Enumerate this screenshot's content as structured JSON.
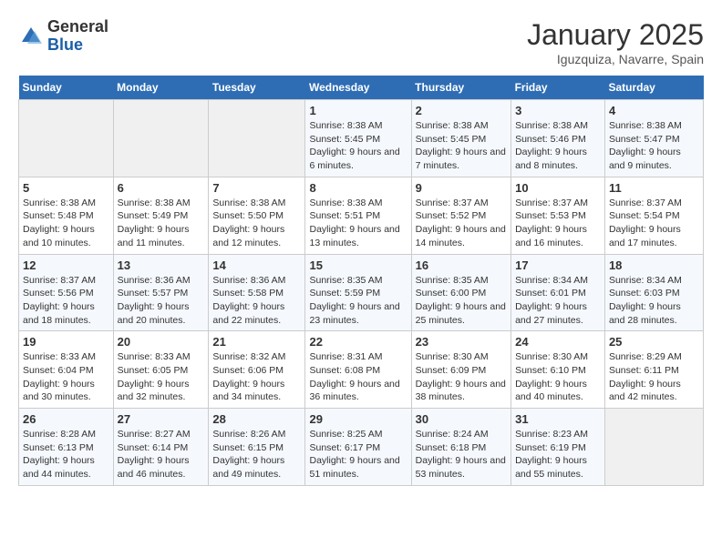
{
  "header": {
    "logo_general": "General",
    "logo_blue": "Blue",
    "month_title": "January 2025",
    "location": "Iguzquiza, Navarre, Spain"
  },
  "weekdays": [
    "Sunday",
    "Monday",
    "Tuesday",
    "Wednesday",
    "Thursday",
    "Friday",
    "Saturday"
  ],
  "weeks": [
    [
      {
        "day": "",
        "sunrise": "",
        "sunset": "",
        "daylight": ""
      },
      {
        "day": "",
        "sunrise": "",
        "sunset": "",
        "daylight": ""
      },
      {
        "day": "",
        "sunrise": "",
        "sunset": "",
        "daylight": ""
      },
      {
        "day": "1",
        "sunrise": "Sunrise: 8:38 AM",
        "sunset": "Sunset: 5:45 PM",
        "daylight": "Daylight: 9 hours and 6 minutes."
      },
      {
        "day": "2",
        "sunrise": "Sunrise: 8:38 AM",
        "sunset": "Sunset: 5:45 PM",
        "daylight": "Daylight: 9 hours and 7 minutes."
      },
      {
        "day": "3",
        "sunrise": "Sunrise: 8:38 AM",
        "sunset": "Sunset: 5:46 PM",
        "daylight": "Daylight: 9 hours and 8 minutes."
      },
      {
        "day": "4",
        "sunrise": "Sunrise: 8:38 AM",
        "sunset": "Sunset: 5:47 PM",
        "daylight": "Daylight: 9 hours and 9 minutes."
      }
    ],
    [
      {
        "day": "5",
        "sunrise": "Sunrise: 8:38 AM",
        "sunset": "Sunset: 5:48 PM",
        "daylight": "Daylight: 9 hours and 10 minutes."
      },
      {
        "day": "6",
        "sunrise": "Sunrise: 8:38 AM",
        "sunset": "Sunset: 5:49 PM",
        "daylight": "Daylight: 9 hours and 11 minutes."
      },
      {
        "day": "7",
        "sunrise": "Sunrise: 8:38 AM",
        "sunset": "Sunset: 5:50 PM",
        "daylight": "Daylight: 9 hours and 12 minutes."
      },
      {
        "day": "8",
        "sunrise": "Sunrise: 8:38 AM",
        "sunset": "Sunset: 5:51 PM",
        "daylight": "Daylight: 9 hours and 13 minutes."
      },
      {
        "day": "9",
        "sunrise": "Sunrise: 8:37 AM",
        "sunset": "Sunset: 5:52 PM",
        "daylight": "Daylight: 9 hours and 14 minutes."
      },
      {
        "day": "10",
        "sunrise": "Sunrise: 8:37 AM",
        "sunset": "Sunset: 5:53 PM",
        "daylight": "Daylight: 9 hours and 16 minutes."
      },
      {
        "day": "11",
        "sunrise": "Sunrise: 8:37 AM",
        "sunset": "Sunset: 5:54 PM",
        "daylight": "Daylight: 9 hours and 17 minutes."
      }
    ],
    [
      {
        "day": "12",
        "sunrise": "Sunrise: 8:37 AM",
        "sunset": "Sunset: 5:56 PM",
        "daylight": "Daylight: 9 hours and 18 minutes."
      },
      {
        "day": "13",
        "sunrise": "Sunrise: 8:36 AM",
        "sunset": "Sunset: 5:57 PM",
        "daylight": "Daylight: 9 hours and 20 minutes."
      },
      {
        "day": "14",
        "sunrise": "Sunrise: 8:36 AM",
        "sunset": "Sunset: 5:58 PM",
        "daylight": "Daylight: 9 hours and 22 minutes."
      },
      {
        "day": "15",
        "sunrise": "Sunrise: 8:35 AM",
        "sunset": "Sunset: 5:59 PM",
        "daylight": "Daylight: 9 hours and 23 minutes."
      },
      {
        "day": "16",
        "sunrise": "Sunrise: 8:35 AM",
        "sunset": "Sunset: 6:00 PM",
        "daylight": "Daylight: 9 hours and 25 minutes."
      },
      {
        "day": "17",
        "sunrise": "Sunrise: 8:34 AM",
        "sunset": "Sunset: 6:01 PM",
        "daylight": "Daylight: 9 hours and 27 minutes."
      },
      {
        "day": "18",
        "sunrise": "Sunrise: 8:34 AM",
        "sunset": "Sunset: 6:03 PM",
        "daylight": "Daylight: 9 hours and 28 minutes."
      }
    ],
    [
      {
        "day": "19",
        "sunrise": "Sunrise: 8:33 AM",
        "sunset": "Sunset: 6:04 PM",
        "daylight": "Daylight: 9 hours and 30 minutes."
      },
      {
        "day": "20",
        "sunrise": "Sunrise: 8:33 AM",
        "sunset": "Sunset: 6:05 PM",
        "daylight": "Daylight: 9 hours and 32 minutes."
      },
      {
        "day": "21",
        "sunrise": "Sunrise: 8:32 AM",
        "sunset": "Sunset: 6:06 PM",
        "daylight": "Daylight: 9 hours and 34 minutes."
      },
      {
        "day": "22",
        "sunrise": "Sunrise: 8:31 AM",
        "sunset": "Sunset: 6:08 PM",
        "daylight": "Daylight: 9 hours and 36 minutes."
      },
      {
        "day": "23",
        "sunrise": "Sunrise: 8:30 AM",
        "sunset": "Sunset: 6:09 PM",
        "daylight": "Daylight: 9 hours and 38 minutes."
      },
      {
        "day": "24",
        "sunrise": "Sunrise: 8:30 AM",
        "sunset": "Sunset: 6:10 PM",
        "daylight": "Daylight: 9 hours and 40 minutes."
      },
      {
        "day": "25",
        "sunrise": "Sunrise: 8:29 AM",
        "sunset": "Sunset: 6:11 PM",
        "daylight": "Daylight: 9 hours and 42 minutes."
      }
    ],
    [
      {
        "day": "26",
        "sunrise": "Sunrise: 8:28 AM",
        "sunset": "Sunset: 6:13 PM",
        "daylight": "Daylight: 9 hours and 44 minutes."
      },
      {
        "day": "27",
        "sunrise": "Sunrise: 8:27 AM",
        "sunset": "Sunset: 6:14 PM",
        "daylight": "Daylight: 9 hours and 46 minutes."
      },
      {
        "day": "28",
        "sunrise": "Sunrise: 8:26 AM",
        "sunset": "Sunset: 6:15 PM",
        "daylight": "Daylight: 9 hours and 49 minutes."
      },
      {
        "day": "29",
        "sunrise": "Sunrise: 8:25 AM",
        "sunset": "Sunset: 6:17 PM",
        "daylight": "Daylight: 9 hours and 51 minutes."
      },
      {
        "day": "30",
        "sunrise": "Sunrise: 8:24 AM",
        "sunset": "Sunset: 6:18 PM",
        "daylight": "Daylight: 9 hours and 53 minutes."
      },
      {
        "day": "31",
        "sunrise": "Sunrise: 8:23 AM",
        "sunset": "Sunset: 6:19 PM",
        "daylight": "Daylight: 9 hours and 55 minutes."
      },
      {
        "day": "",
        "sunrise": "",
        "sunset": "",
        "daylight": ""
      }
    ]
  ]
}
